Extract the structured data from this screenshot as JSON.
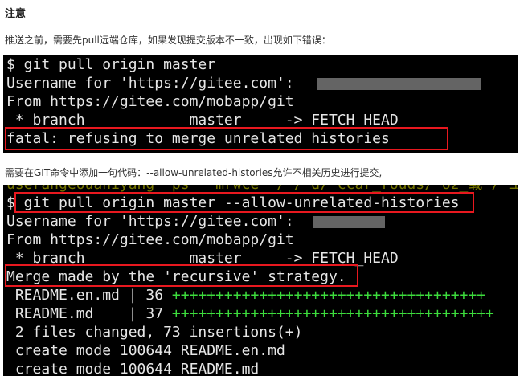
{
  "heading": "注意",
  "intro_text": "推送之前，需要先pull远端仓库，如果发现提交版本不一致，出现如下错误：",
  "term1": {
    "lines": [
      "$ git pull origin master",
      "Username for 'https://gitee.com': ",
      "From https://gitee.com/mobapp/git",
      " * branch            master     -> FETCH_HEAD",
      "fatal: refusing to merge unrelated histories"
    ]
  },
  "middle_text": "需要在GIT命令中添加一句代码：--allow-unrelated-histories允许不相关历史进行提交,",
  "term2": {
    "lines": [
      "$ git pull origin master --allow-unrelated-histories",
      "Username for 'https://gitee.com': ",
      "From https://gitee.com/mobapp/git",
      " * branch            master     -> FETCH_HEAD",
      "Merge made by the 'recursive' strategy.",
      " README.en.md | 36 ",
      " README.md    | 37 ",
      " 2 files changed, 73 insertions(+)",
      " create mode 100644 README.en.md",
      " create mode 100644 README.md"
    ],
    "plus_bars": [
      "++++++++++++++++++++++++++++++++++++",
      "+++++++++++++++++++++++++++++++++++++"
    ]
  },
  "colors": {
    "terminal_bg": "#000000",
    "terminal_text": "#e6e6e6",
    "highlight_box": "#e8181f",
    "diff_plus": "#3ddc3d"
  }
}
